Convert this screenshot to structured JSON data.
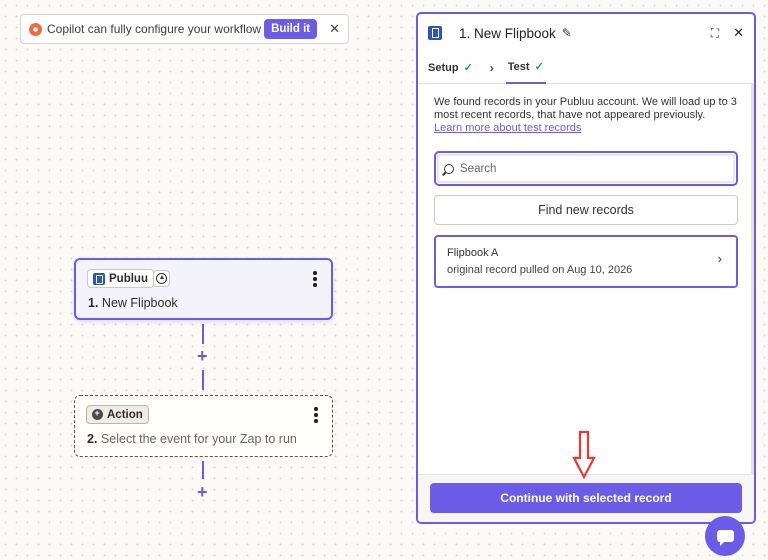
{
  "copilot": {
    "message": "Copilot can fully configure your workflow",
    "build_label": "Build it",
    "close_glyph": "✕"
  },
  "canvas": {
    "trigger_step": {
      "app_name": "Publuu",
      "number": "1.",
      "title": "New Flipbook"
    },
    "action_step": {
      "app_name": "Action",
      "number": "2.",
      "title": "Select the event for your Zap to run"
    },
    "add_glyph": "+"
  },
  "panel": {
    "title": "1. New Flipbook",
    "close_glyph": "✕",
    "tabs": [
      {
        "label": "Setup",
        "check": "✓"
      },
      {
        "label": "Test",
        "check": "✓"
      }
    ],
    "info_text": "We found records in your Publuu account. We will load up to 3 most recent records, that have not appeared previously.",
    "info_link": "Learn more about test records",
    "search_placeholder": "Search",
    "find_label": "Find new records",
    "records": [
      {
        "title": "Flipbook A",
        "subtitle": "original record pulled on Aug 10, 2026"
      }
    ],
    "continue_label": "Continue with selected record"
  },
  "colors": {
    "accent": "#6b5ce7",
    "success": "#1e9e52",
    "annotation": "#e53935"
  },
  "icons": [
    "copilot-icon",
    "publuu-logo-icon",
    "trigger-status-icon",
    "kebab-icon",
    "pencil-icon",
    "expand-icon",
    "search-icon",
    "chevron-right-icon",
    "chat-icon"
  ]
}
